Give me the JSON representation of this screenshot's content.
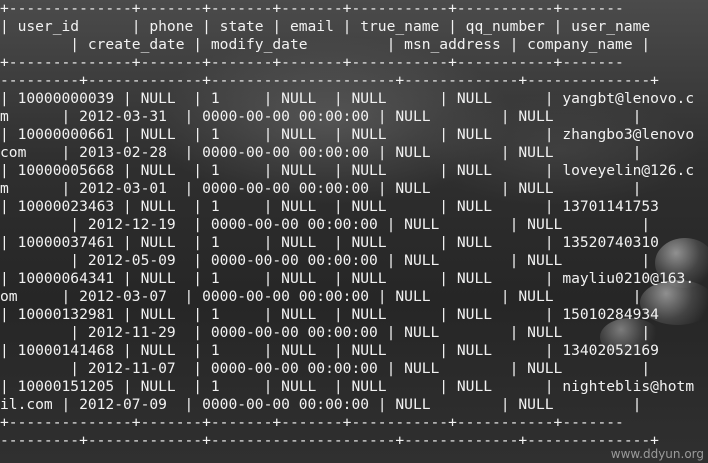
{
  "terminal": {
    "lines": [
      "+--------------+-------+-------+-------+-----------+-----------+-------",
      "| user_id      | phone | state | email | true_name | qq_number | user_name",
      "        | create_date | modify_date         | msn_address | company_name |",
      "+--------------+-------+-------+-------+-----------+-----------+-------",
      "---------+-------------+---------------------+-------------+--------------+",
      "| 10000000039 | NULL  | 1     | NULL  | NULL      | NULL      | yangbt@lenovo.c",
      "m      | 2012-03-31  | 0000-00-00 00:00:00 | NULL        | NULL         |",
      "| 10000000661 | NULL  | 1     | NULL  | NULL      | NULL      | zhangbo3@lenovo",
      "com    | 2013-02-28  | 0000-00-00 00:00:00 | NULL        | NULL         |",
      "| 10000005668 | NULL  | 1     | NULL  | NULL      | NULL      | loveyelin@126.c",
      "m      | 2012-03-01  | 0000-00-00 00:00:00 | NULL        | NULL         |",
      "| 10000023463 | NULL  | 1     | NULL  | NULL      | NULL      | 13701141753",
      "        | 2012-12-19  | 0000-00-00 00:00:00 | NULL        | NULL         |",
      "| 10000037461 | NULL  | 1     | NULL  | NULL      | NULL      | 13520740310",
      "        | 2012-05-09  | 0000-00-00 00:00:00 | NULL        | NULL         |",
      "| 10000064341 | NULL  | 1     | NULL  | NULL      | NULL      | mayliu0210@163.",
      "om     | 2012-03-07  | 0000-00-00 00:00:00 | NULL        | NULL         |",
      "| 10000132981 | NULL  | 1     | NULL  | NULL      | NULL      | 15010284934",
      "        | 2012-11-29  | 0000-00-00 00:00:00 | NULL        | NULL         |",
      "| 10000141468 | NULL  | 1     | NULL  | NULL      | NULL      | 13402052169",
      "        | 2012-11-07  | 0000-00-00 00:00:00 | NULL        | NULL         |",
      "| 10000151205 | NULL  | 1     | NULL  | NULL      | NULL      | nighteblis@hotm",
      "il.com | 2012-07-09  | 0000-00-00 00:00:00 | NULL        | NULL         |",
      "+--------------+-------+-------+-------+-----------+-----------+-------",
      "---------+-------------+---------------------+-------------+--------------+"
    ]
  },
  "watermark": "www.ddyun.org"
}
